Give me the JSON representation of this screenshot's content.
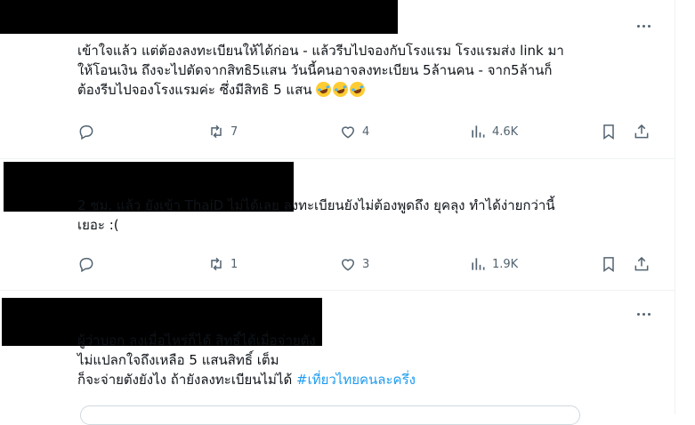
{
  "tweets": [
    {
      "lines": [
        "เข้าใจแล้ว  แต่ต้องลงทะเบียนให้ได้ก่อน - แล้วรีบไปจองกับโรงแรม โรงแรมส่ง link มา",
        "ให้โอนเงิน ถึงจะไปตัดจากสิทธิ5แสน  วันนี้คนอาจลงทะเบียน 5ล้านคน - จาก5ล้านก็",
        "ต้องรีบไปจองโรงแรมค่ะ ซึ่งมีสิทธิ 5 แสน "
      ],
      "emojis": [
        "rolling-on-floor-laughing",
        "rolling-on-floor-laughing",
        "rolling-on-floor-laughing"
      ],
      "replies": "",
      "reposts": "7",
      "likes": "4",
      "views": "4.6K"
    },
    {
      "lines": [
        "2 ชม. แล้ว ยังเข้า ThaiD ไม่ได้เลย ลงทะเบียนยังไม่ต้องพูดถึง ยุคลุง ทำได้ง่ายกว่านี้",
        "เยอะ :("
      ],
      "replies": "",
      "reposts": "1",
      "likes": "3",
      "views": "1.9K"
    },
    {
      "lines": [
        "ผู้ว่าบอก ลงเมื่อไหร่ก็ได้ สิทธิ์ได้เมื่อจ่ายตัง",
        "ไม่แปลกใจถึงเหลือ 5 แสนสิทธิ์ เต็ม",
        "ก็จะจ่ายตังยังไง  ถ้ายังลงทะเบียนไม่ได้ "
      ],
      "hashtag": "#เที่ยวไทยคนละครึ่ง"
    }
  ],
  "icons": {
    "more": "more-horizontal-icon",
    "reply": "reply-bubble-icon",
    "repost": "repost-icon",
    "like": "heart-icon",
    "views": "views-bar-chart-icon",
    "bookmark": "bookmark-icon",
    "share": "share-icon"
  },
  "colors": {
    "text": "#0f1419",
    "secondary": "#536471",
    "hashtag": "#1d9bf0",
    "divider": "#eff3f4",
    "redaction": "#000000"
  }
}
